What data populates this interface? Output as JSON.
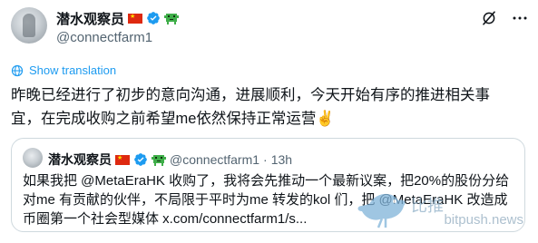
{
  "author": {
    "name": "潜水观察员",
    "handle": "@connectfarm1"
  },
  "icons": {
    "flag": "china-flag-icon",
    "verified": "verified-badge-icon",
    "sprite": "pixel-sprite-icon",
    "grok": "grok-icon",
    "more": "more-options-icon",
    "translate": "globe-icon"
  },
  "translation": {
    "label": "Show translation"
  },
  "tweet": {
    "text": "昨晚已经进行了初步的意向沟通，进展顺利，今天开始有序的推进相关事宜，在完成收购之前希望me依然保持正常运营✌️"
  },
  "quote": {
    "author_name": "潜水观察员",
    "handle": "@connectfarm1",
    "separator": "·",
    "time": "13h",
    "text": "如果我把 @MetaEraHK 收购了，我将会先推动一个最新议案，把20%的股份分给对me 有贡献的伙伴，不局限于平时为me 转发的kol 们，把 @MetaEraHK 改造成币圈第一个社会型媒体 x.com/connectfarm1/s..."
  },
  "watermark": {
    "text": "bitpush.news",
    "glyphs": "比推"
  },
  "colors": {
    "accent": "#1d9bf0",
    "muted": "#536471",
    "border": "#cfd9de",
    "flag_red": "#de2910",
    "sprite_green": "#3fae49"
  }
}
